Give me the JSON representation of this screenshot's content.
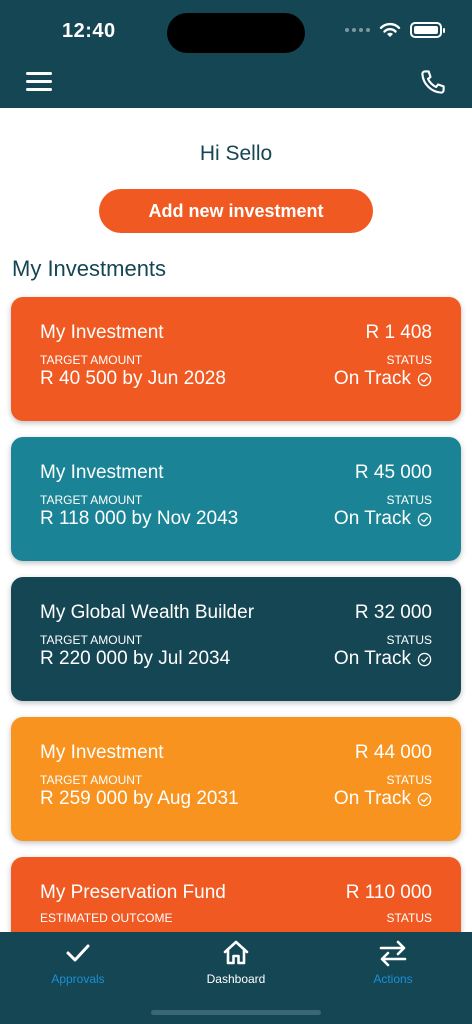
{
  "status_bar": {
    "time": "12:40"
  },
  "header": {
    "menu_icon": "hamburger-menu-icon",
    "phone_icon": "phone-icon"
  },
  "greeting": "Hi Sello",
  "add_button_label": "Add new investment",
  "section_title": "My Investments",
  "colors": {
    "header_bg": "#154654",
    "accent_orange": "#f05a22",
    "card_teal": "#1a8496",
    "card_dark": "#154654",
    "card_amber": "#f7931e",
    "nav_active": "#ffffff",
    "nav_inactive": "#1a8fd6"
  },
  "investments": [
    {
      "name": "My Investment",
      "value": "R 1 408",
      "target_label": "TARGET AMOUNT",
      "target": "R 40 500 by Jun 2028",
      "status_label": "STATUS",
      "status": "On Track",
      "color": "#f05a22"
    },
    {
      "name": "My Investment",
      "value": "R 45 000",
      "target_label": "TARGET AMOUNT",
      "target": "R 118 000 by Nov 2043",
      "status_label": "STATUS",
      "status": "On Track",
      "color": "#1a8496"
    },
    {
      "name": "My Global Wealth Builder",
      "value": "R 32 000",
      "target_label": "TARGET AMOUNT",
      "target": "R 220 000 by Jul 2034",
      "status_label": "STATUS",
      "status": "On Track",
      "color": "#154654"
    },
    {
      "name": "My Investment",
      "value": "R 44 000",
      "target_label": "TARGET AMOUNT",
      "target": "R 259 000 by Aug 2031",
      "status_label": "STATUS",
      "status": "On Track",
      "color": "#f7931e"
    },
    {
      "name": "My Preservation Fund",
      "value": "R 110 000",
      "target_label": "ESTIMATED OUTCOME",
      "target": "",
      "status_label": "STATUS",
      "status": "",
      "color": "#f05a22"
    }
  ],
  "bottom_nav": [
    {
      "label": "Approvals",
      "icon": "checkmark-icon",
      "active": false
    },
    {
      "label": "Dashboard",
      "icon": "home-icon",
      "active": true
    },
    {
      "label": "Actions",
      "icon": "transfer-arrows-icon",
      "active": false
    }
  ]
}
